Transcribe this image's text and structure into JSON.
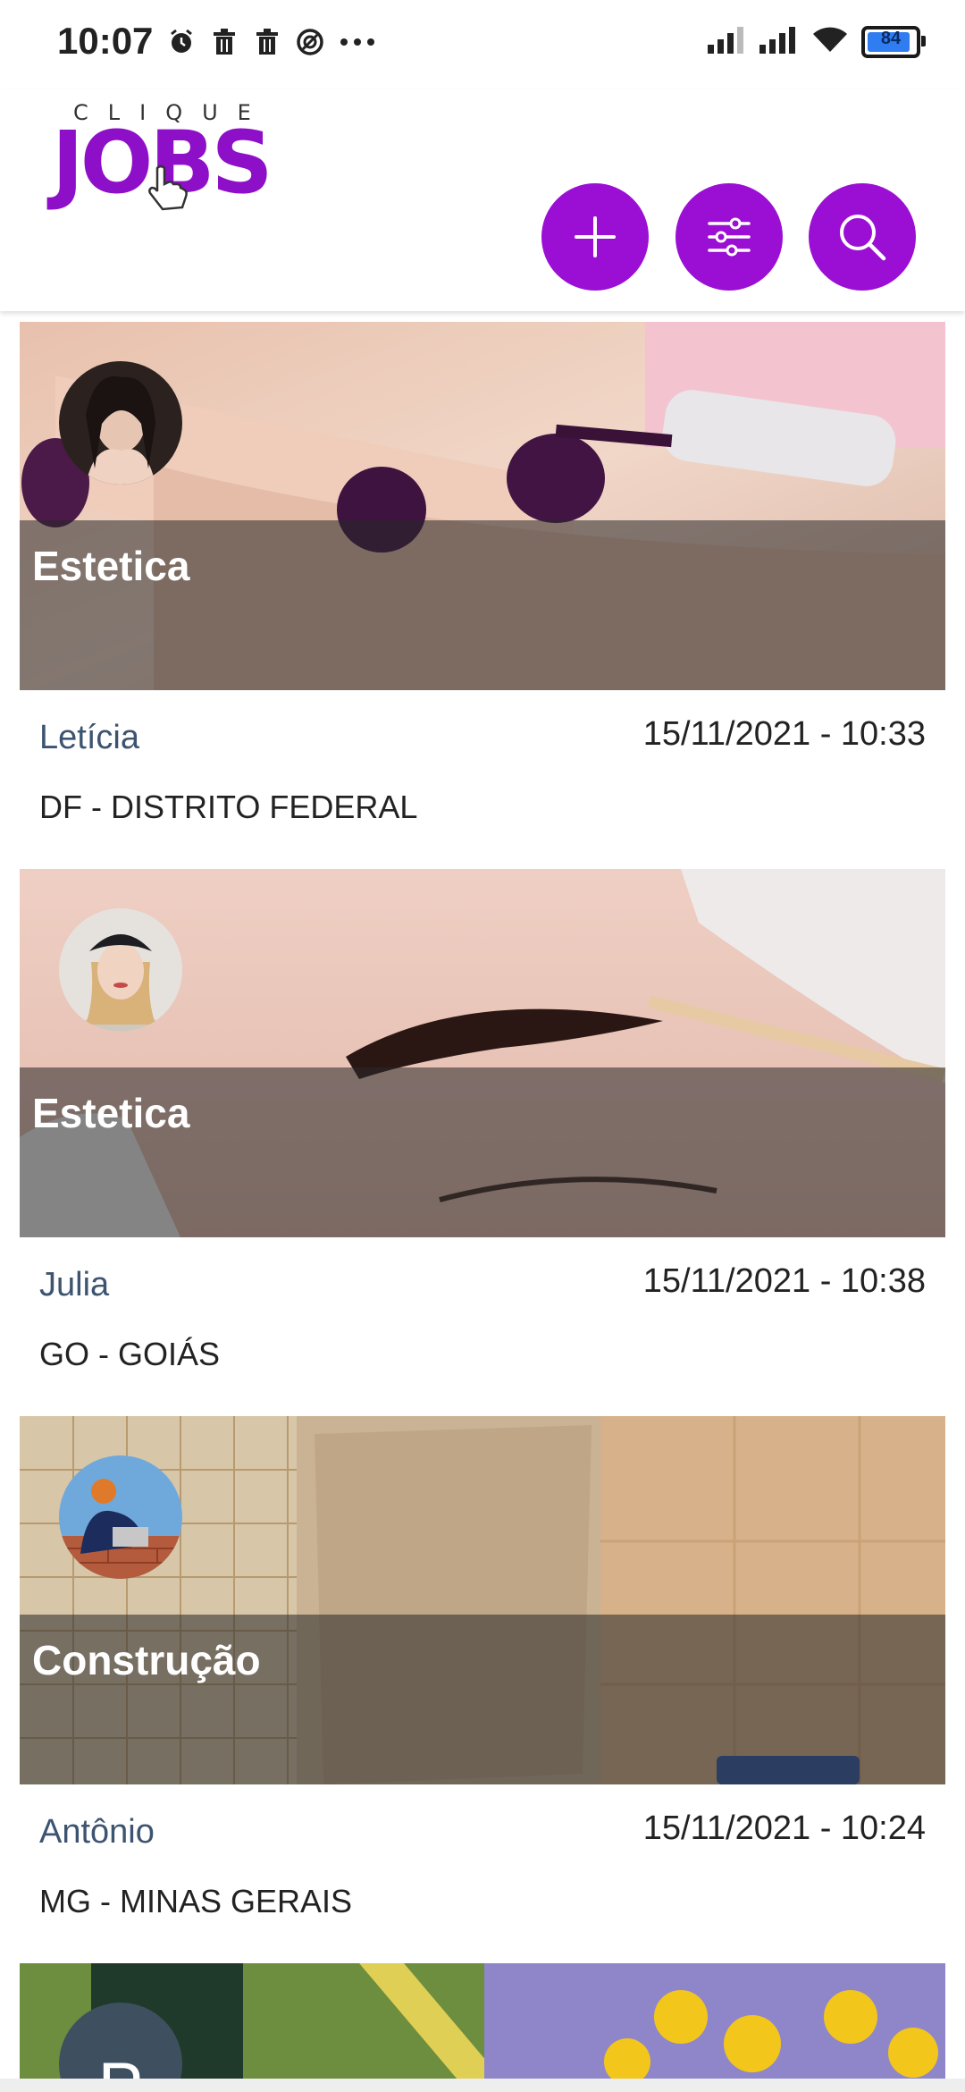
{
  "status_bar": {
    "time": "10:07",
    "left_icons": [
      "alarm-icon",
      "trash-icon",
      "trash-icon",
      "vpn-icon",
      "more-icon"
    ],
    "right_icons": [
      "signal-icon",
      "signal-icon",
      "wifi-icon",
      "battery-icon"
    ],
    "battery_level": "84"
  },
  "header": {
    "logo_top": "CLIQUE",
    "logo_main": "JOBS",
    "buttons": [
      {
        "name": "add-button",
        "icon": "plus-icon"
      },
      {
        "name": "filter-button",
        "icon": "sliders-icon"
      },
      {
        "name": "search-button",
        "icon": "search-icon"
      }
    ],
    "accent_color": "#9b0fd4"
  },
  "cards": [
    {
      "category": "Estetica",
      "name": "Letícia",
      "date": "15/11/2021 - 10:33",
      "location": "DF - DISTRITO FEDERAL"
    },
    {
      "category": "Estetica",
      "name": "Julia",
      "date": "15/11/2021 - 10:38",
      "location": "GO - GOIÁS"
    },
    {
      "category": "Construção",
      "name": "Antônio",
      "date": "15/11/2021 - 10:24",
      "location": "MG - MINAS GERAIS"
    },
    {
      "avatar_letter": "P"
    }
  ]
}
